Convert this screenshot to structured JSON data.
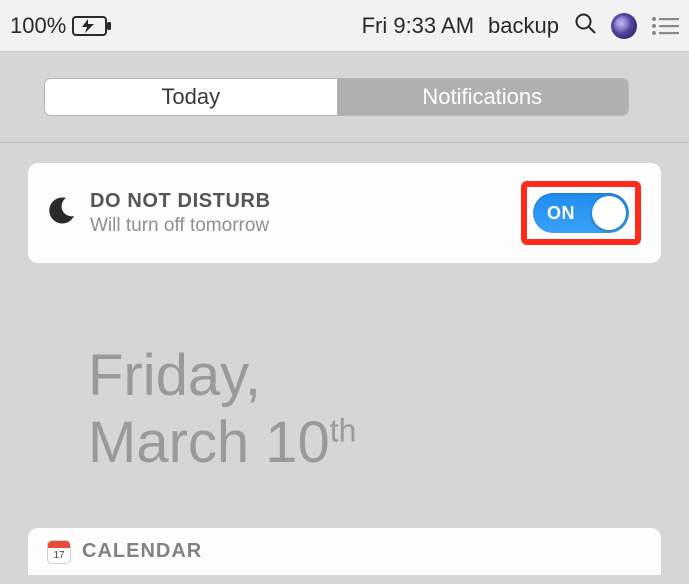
{
  "menubar": {
    "battery_percent": "100%",
    "datetime": "Fri 9:33 AM",
    "app_name": "backup"
  },
  "tabs": {
    "today": "Today",
    "notifications": "Notifications"
  },
  "dnd": {
    "title": "DO NOT DISTURB",
    "subtitle": "Will turn off tomorrow",
    "toggle_state": "ON"
  },
  "date": {
    "weekday": "Friday,",
    "month_day": "March 10",
    "ordinal": "th"
  },
  "calendar": {
    "title": "CALENDAR",
    "icon_day": "17"
  }
}
